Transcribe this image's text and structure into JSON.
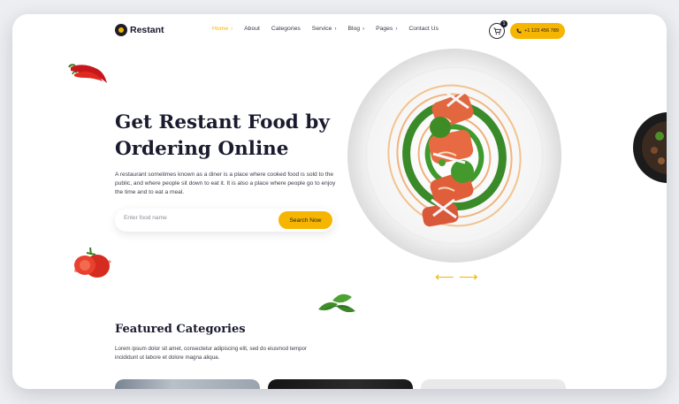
{
  "brand": {
    "name": "Restant"
  },
  "nav": {
    "items": [
      {
        "label": "Home",
        "has_menu": true,
        "active": true
      },
      {
        "label": "About",
        "has_menu": false
      },
      {
        "label": "Categories",
        "has_menu": false
      },
      {
        "label": "Service",
        "has_menu": true
      },
      {
        "label": "Blog",
        "has_menu": true
      },
      {
        "label": "Pages",
        "has_menu": true
      },
      {
        "label": "Contact Us",
        "has_menu": false
      }
    ],
    "cart_count": "1",
    "phone": "+1 123 456 789"
  },
  "hero": {
    "title_line1": "Get Restant Food by",
    "title_line2": "Ordering Online",
    "description": "A restaurant sometimes known as a diner is a place where cooked food is sold to the public, and where people sit down to eat it. It is also a place where people go to enjoy the time and to eat a meal.",
    "search_placeholder": "Enter food name",
    "search_button": "Search Now"
  },
  "featured": {
    "title": "Featured Categories",
    "description": "Lorem ipsum dolor sit amet, consectetur adipiscing elit, sed do eiusmod tempor incididunt ut labore et dolore magna aliqua."
  },
  "colors": {
    "accent": "#f6b500",
    "text": "#1b1b2f",
    "background": "#eceef1"
  },
  "icons": {
    "cart": "cart-icon",
    "phone": "phone-icon",
    "prev": "arrow-left-icon",
    "next": "arrow-right-icon"
  }
}
